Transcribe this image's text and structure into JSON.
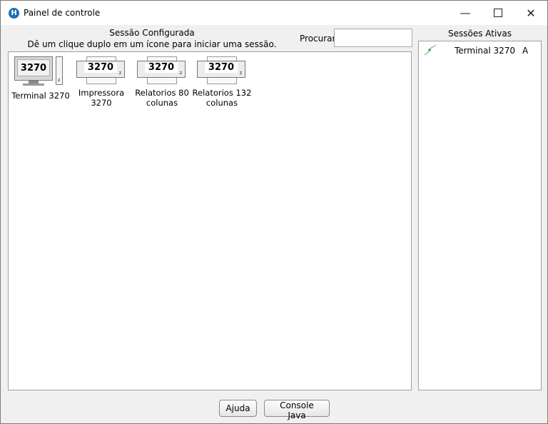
{
  "window": {
    "title": "Painel de controle",
    "app_icon_letter": "H",
    "controls": {
      "minimize": "—",
      "close": "✕"
    }
  },
  "configured": {
    "title": "Sessão Configurada",
    "hint": "Dê um clique duplo em um ícone para iniciar uma sessão.",
    "search_label": "Procurar",
    "search_value": "",
    "sessions": [
      {
        "label": "Terminal 3270",
        "icon": "terminal-icon",
        "badge": "3270"
      },
      {
        "label": "Impressora 3270",
        "icon": "printer-icon",
        "badge": "3270"
      },
      {
        "label": "Relatorios 80 colunas",
        "icon": "printer-icon",
        "badge": "3270"
      },
      {
        "label": "Relatorios 132 colunas",
        "icon": "printer-icon",
        "badge": "3270"
      }
    ]
  },
  "active": {
    "title": "Sessões Ativas",
    "sessions": [
      {
        "name": "Terminal 3270",
        "id": "A",
        "icon": "lightning-icon",
        "icon_color": "#2fb84a"
      }
    ]
  },
  "buttons": {
    "help": "Ajuda",
    "java_console": "Console Java"
  },
  "colors": {
    "app_icon": "#1b6fb5",
    "active_icon": "#2fb84a"
  }
}
